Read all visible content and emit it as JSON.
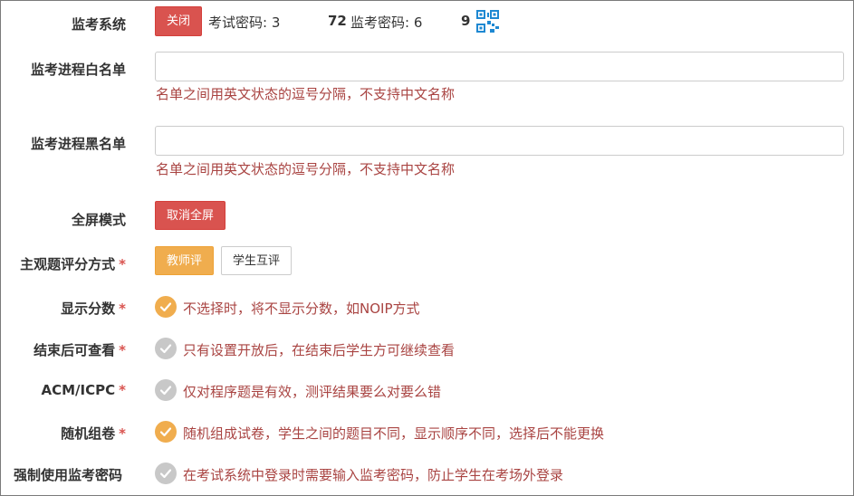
{
  "monitor_system": {
    "label": "监考系统",
    "close_button": "关闭",
    "exam_password_label": "考试密码: 3",
    "exam_password_tail": "72",
    "monitor_password_label": "监考密码: 6",
    "monitor_password_tail": "9",
    "qr_icon": "qrcode-icon"
  },
  "whitelist": {
    "label": "监考进程白名单",
    "value": "",
    "help": "名单之间用英文状态的逗号分隔，不支持中文名称"
  },
  "blacklist": {
    "label": "监考进程黑名单",
    "value": "",
    "help": "名单之间用英文状态的逗号分隔，不支持中文名称"
  },
  "fullscreen": {
    "label": "全屏模式",
    "button": "取消全屏"
  },
  "grading": {
    "label": "主观题评分方式",
    "required": "*",
    "options": [
      "教师评",
      "学生互评"
    ],
    "selected": "教师评"
  },
  "toggles": [
    {
      "label": "显示分数",
      "required": "*",
      "checked": true,
      "text": "不选择时，将不显示分数，如NOIP方式"
    },
    {
      "label": "结束后可查看",
      "required": "*",
      "checked": false,
      "text": "只有设置开放后，在结束后学生方可继续查看"
    },
    {
      "label": "ACM/ICPC",
      "required": "*",
      "checked": false,
      "text": "仅对程序题是有效，测评结果要么对要么错"
    },
    {
      "label": "随机组卷",
      "required": "*",
      "checked": true,
      "text": "随机组成试卷，学生之间的题目不同，显示顺序不同，选择后不能更换"
    },
    {
      "label": "强制使用监考密码",
      "required": "",
      "checked": false,
      "text": "在考试系统中登录时需要输入监考密码，防止学生在考场外登录"
    }
  ],
  "colors": {
    "danger": "#d9534f",
    "warning": "#f0ad4e",
    "help_text": "#a94442",
    "check_off": "#c8c8c8",
    "qr": "#1e88d2"
  }
}
